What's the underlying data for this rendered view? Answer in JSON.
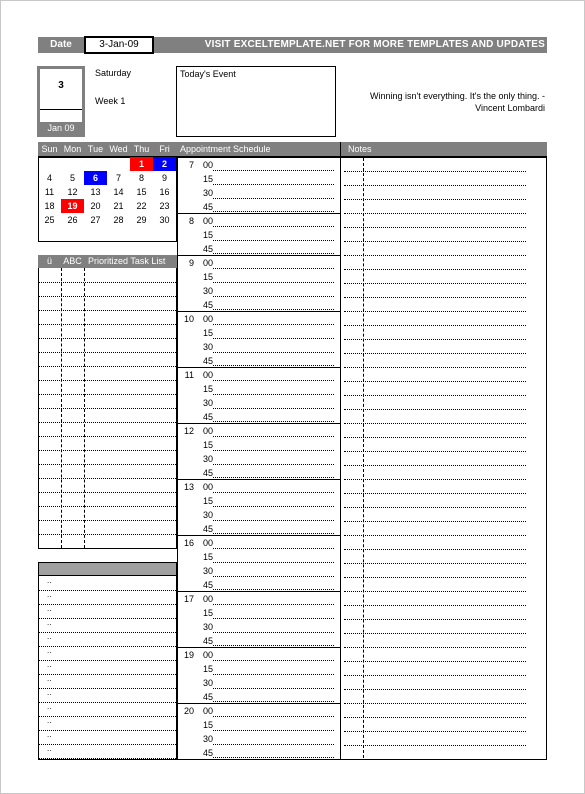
{
  "header": {
    "date_label": "Date",
    "date_value": "3-Jan-09",
    "promo": "VISIT EXCELTEMPLATE.NET FOR MORE TEMPLATES AND UPDATES"
  },
  "day": {
    "number": "3",
    "month": "Jan 09",
    "weekday": "Saturday",
    "week": "Week 1"
  },
  "event": {
    "label": "Today's Event"
  },
  "quote": {
    "text": "Winning isn't everything. It's the only thing. -",
    "author": "Vincent Lombardi"
  },
  "calendar": {
    "days": [
      "Sun",
      "Mon",
      "Tue",
      "Wed",
      "Thu",
      "Fri"
    ],
    "weeks": [
      [
        "",
        "",
        "",
        "",
        "1",
        "2"
      ],
      [
        "4",
        "5",
        "6",
        "7",
        "8",
        "9"
      ],
      [
        "11",
        "12",
        "13",
        "14",
        "15",
        "16"
      ],
      [
        "18",
        "19",
        "20",
        "21",
        "22",
        "23"
      ],
      [
        "25",
        "26",
        "27",
        "28",
        "29",
        "30"
      ]
    ],
    "highlights": {
      "1": "#ff0000",
      "2": "#0000ff",
      "6": "#0000ff",
      "19": "#ff0000"
    }
  },
  "schedule": {
    "title": "Appointment Schedule",
    "hours": [
      {
        "h": "7",
        "m": [
          "00",
          "15",
          "30",
          "45"
        ]
      },
      {
        "h": "8",
        "m": [
          "00",
          "15",
          "45"
        ]
      },
      {
        "h": "9",
        "m": [
          "00",
          "15",
          "30",
          "45"
        ]
      },
      {
        "h": "10",
        "m": [
          "00",
          "15",
          "30",
          "45"
        ]
      },
      {
        "h": "11",
        "m": [
          "00",
          "15",
          "30",
          "45"
        ]
      },
      {
        "h": "12",
        "m": [
          "00",
          "15",
          "30",
          "45"
        ]
      },
      {
        "h": "13",
        "m": [
          "00",
          "15",
          "30",
          "45"
        ]
      },
      {
        "h": "16",
        "m": [
          "00",
          "15",
          "30",
          "45"
        ]
      },
      {
        "h": "17",
        "m": [
          "00",
          "15",
          "30",
          "45"
        ]
      },
      {
        "h": "19",
        "m": [
          "00",
          "15",
          "30",
          "45"
        ]
      },
      {
        "h": "20",
        "m": [
          "00",
          "15",
          "30",
          "45"
        ]
      }
    ]
  },
  "notes": {
    "title": "Notes"
  },
  "tasks": {
    "col_check": "ü",
    "col_abc": "ABC",
    "col_title": "Prioritized Task List"
  },
  "bottom_list": {
    "marker": ".."
  },
  "colors": {
    "header_gray": "#808080",
    "red": "#ff0000",
    "blue": "#0000ff"
  }
}
